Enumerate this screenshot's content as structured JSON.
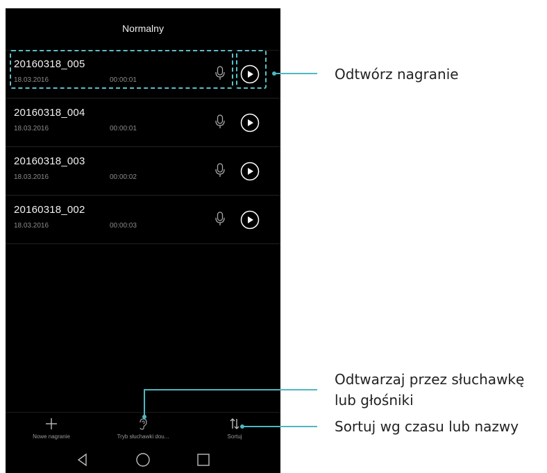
{
  "header": {
    "title": "Normalny"
  },
  "recordings": [
    {
      "name": "20160318_005",
      "date": "18.03.2016",
      "duration": "00:00:01"
    },
    {
      "name": "20160318_004",
      "date": "18.03.2016",
      "duration": "00:00:01"
    },
    {
      "name": "20160318_003",
      "date": "18.03.2016",
      "duration": "00:00:02"
    },
    {
      "name": "20160318_002",
      "date": "18.03.2016",
      "duration": "00:00:03"
    }
  ],
  "toolbar": {
    "new_label": "Nowe nagranie",
    "mode_label": "Tryb słuchawki dou...",
    "sort_label": "Sortuj"
  },
  "callouts": {
    "play": "Odtwórz nagranie",
    "earpiece_line1": "Odtwarzaj przez słuchawkę",
    "earpiece_line2": "lub głośniki",
    "sort": "Sortuj wg czasu lub nazwy"
  },
  "colors": {
    "accent": "#4db8c2",
    "background": "#000000",
    "secondary_text": "#8c8c8c"
  },
  "icons": {
    "mic": "microphone-icon",
    "play": "play-icon",
    "add": "plus-icon",
    "ear": "ear-icon",
    "sort": "sort-icon",
    "back": "back-triangle-icon",
    "home": "home-circle-icon",
    "recent": "recent-square-icon"
  }
}
